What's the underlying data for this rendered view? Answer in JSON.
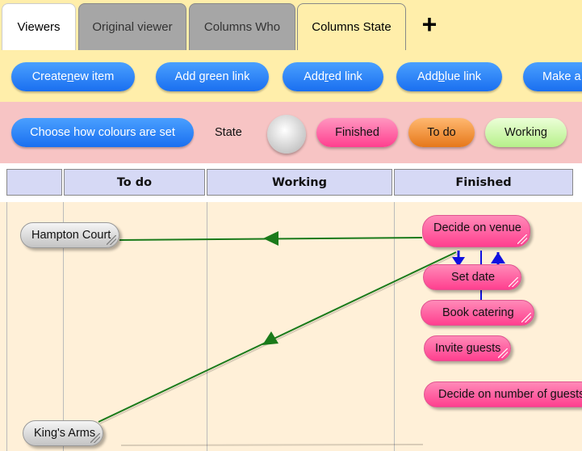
{
  "tabs": [
    {
      "label": "Viewers"
    },
    {
      "label": "Original viewer"
    },
    {
      "label": "Columns Who"
    },
    {
      "label": "Columns State"
    }
  ],
  "add_tab_label": "+",
  "toolbar": {
    "create_pre": "Create ",
    "create_u": "n",
    "create_post": "ew item",
    "green_link": "Add green link",
    "red_pre": "Add ",
    "red_u": "r",
    "red_post": "ed link",
    "blue_pre": "Add ",
    "blue_u": "b",
    "blue_post": "lue link",
    "make": "Make a"
  },
  "colourbar": {
    "choose_label": "Choose how colours are set",
    "state_label": "State",
    "legend": [
      {
        "label": "Finished",
        "color": "#ff5a9e"
      },
      {
        "label": "To do",
        "color": "#f08a2a"
      },
      {
        "label": "Working",
        "color": "#c6ff9a"
      }
    ]
  },
  "columns": [
    "",
    "To do",
    "Working",
    "Finished"
  ],
  "items": [
    {
      "label": "Hampton Court",
      "state": "grey"
    },
    {
      "label": "King's Arms",
      "state": "grey"
    },
    {
      "label": "Decide on venue",
      "state": "Finished"
    },
    {
      "label": "Set date",
      "state": "Finished"
    },
    {
      "label": "Book catering",
      "state": "Finished"
    },
    {
      "label": "Invite guests",
      "state": "Finished"
    },
    {
      "label": "Decide on number of guests",
      "state": "Finished"
    }
  ],
  "colors": {
    "green_link": "#1a7a1a",
    "blue_link": "#1010e0",
    "pink_node": "#ff4a95",
    "grey_node": "#d8d8d8"
  }
}
